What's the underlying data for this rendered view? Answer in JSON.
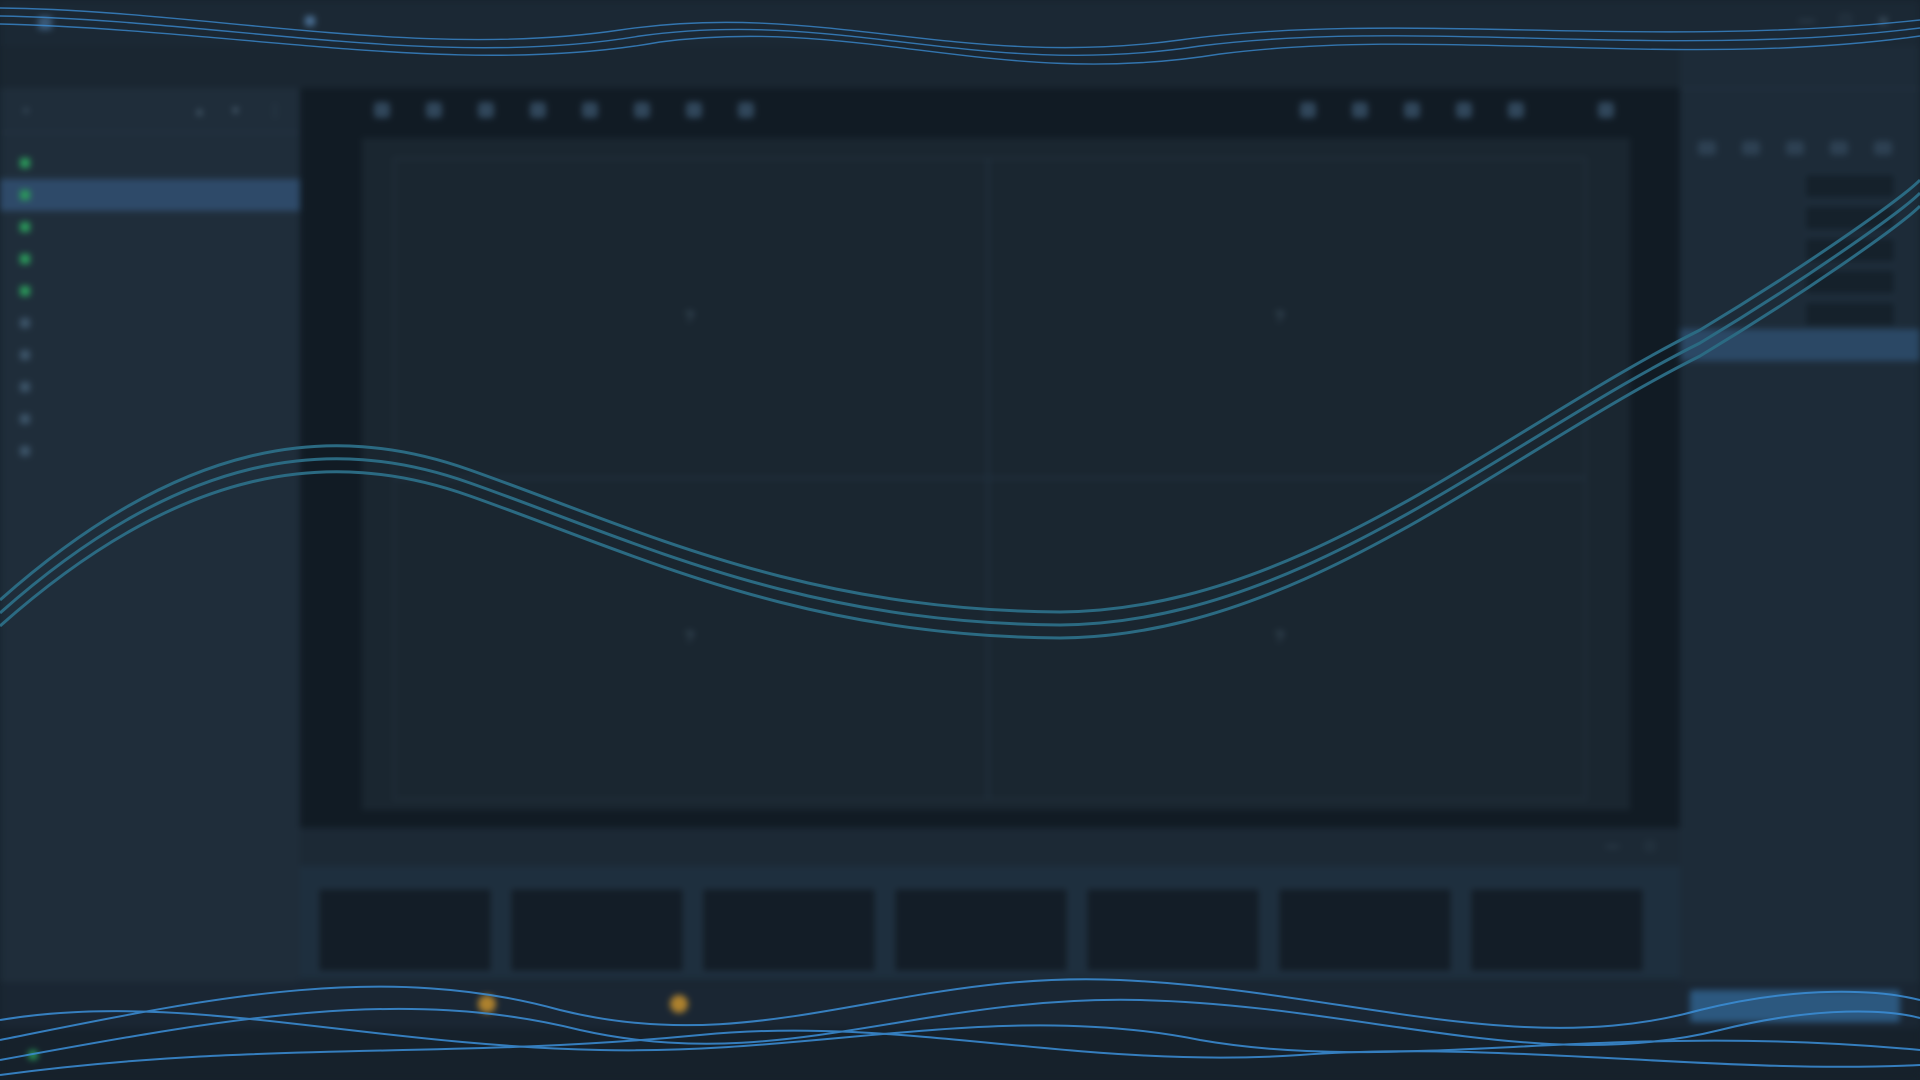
{
  "titlebar": {
    "app_title": "",
    "project_tag": "",
    "menus": [
      "",
      "",
      ""
    ],
    "window_controls": [
      "minimize-icon",
      "maximize-icon",
      "close-icon"
    ]
  },
  "menubar": {
    "items": [
      {
        "label": ""
      },
      {
        "label": ""
      },
      {
        "label": ""
      },
      {
        "label": ""
      },
      {
        "label": ""
      },
      {
        "label": ""
      },
      {
        "label": ""
      },
      {
        "label": ""
      }
    ],
    "active_index": 2,
    "right_label": ""
  },
  "sequence_list": {
    "tools": [
      "add-icon",
      "",
      "up-icon",
      "down-icon",
      "more-icon"
    ],
    "selected_index": 1,
    "items": [
      {
        "label": "",
        "status": "done",
        "flags": ""
      },
      {
        "label": "",
        "status": "done",
        "flags": ""
      },
      {
        "label": "",
        "status": "done",
        "flags": ""
      },
      {
        "label": "",
        "status": "done",
        "flags": ""
      },
      {
        "label": "",
        "status": "done",
        "flags": ""
      },
      {
        "label": "",
        "status": "idle",
        "flags": ""
      },
      {
        "label": "",
        "status": "idle",
        "flags": ""
      },
      {
        "label": "",
        "status": "idle",
        "flags": ""
      },
      {
        "label": "",
        "status": "idle",
        "flags": ""
      },
      {
        "label": "",
        "status": "idle",
        "flags": ""
      }
    ]
  },
  "viewport": {
    "title_left": "",
    "title_right": "",
    "sub_label": "",
    "placeholder_glyph": "?"
  },
  "properties": {
    "header": "",
    "search_placeholder": "",
    "rows": [
      {
        "label": "",
        "value": ""
      },
      {
        "label": "",
        "value": ""
      },
      {
        "label": "",
        "value": ""
      },
      {
        "label": "",
        "value": ""
      },
      {
        "label": "",
        "value": ""
      }
    ],
    "selected_row": 5
  },
  "bottom_tabs": {
    "tabs": [
      {
        "label": ""
      },
      {
        "label": ""
      },
      {
        "label": ""
      }
    ],
    "active_index": 0
  },
  "thumbnails": {
    "items": [
      {
        "number": ""
      },
      {
        "number": ""
      },
      {
        "number": ""
      },
      {
        "number": ""
      },
      {
        "number": ""
      },
      {
        "number": ""
      },
      {
        "number": ""
      }
    ]
  },
  "status": {
    "items": [
      "",
      "",
      "",
      "",
      "",
      ""
    ],
    "primary_button": ""
  },
  "footer": {
    "version": ""
  },
  "colors": {
    "accent": "#2d5f87",
    "selection": "#2e4a69",
    "ok_green": "#2a9a5a",
    "warn_amber": "#c8922e",
    "wave_line": "#2b6a82",
    "overlay_wave": "#3b8fd8"
  }
}
